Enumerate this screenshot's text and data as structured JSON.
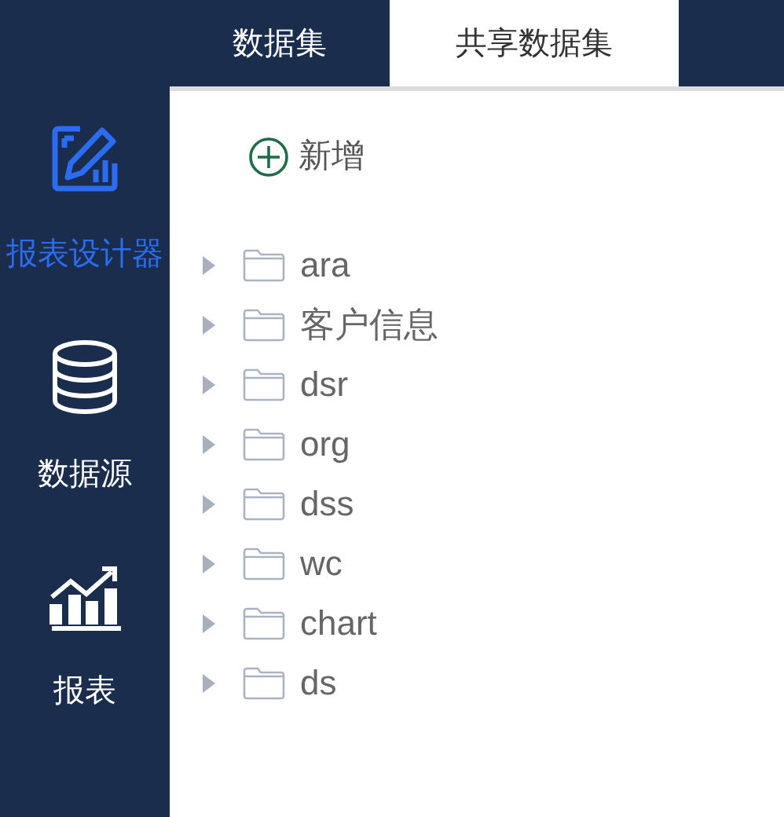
{
  "sidebar": {
    "items": [
      {
        "kind": "designer",
        "label": "报表设计器",
        "selected": true
      },
      {
        "kind": "database",
        "label": "数据源",
        "selected": false
      },
      {
        "kind": "chart",
        "label": "报表",
        "selected": false
      }
    ]
  },
  "tabs": [
    {
      "label": "数据集",
      "selected": false
    },
    {
      "label": "共享数据集",
      "selected": true
    }
  ],
  "add_button": {
    "label": "新增"
  },
  "tree": {
    "items": [
      {
        "label": "ara",
        "expanded": false
      },
      {
        "label": "客户信息",
        "expanded": false
      },
      {
        "label": "dsr",
        "expanded": false
      },
      {
        "label": "org",
        "expanded": false
      },
      {
        "label": "dss",
        "expanded": false
      },
      {
        "label": "wc",
        "expanded": false
      },
      {
        "label": "chart",
        "expanded": false
      },
      {
        "label": "ds",
        "expanded": false
      }
    ]
  }
}
